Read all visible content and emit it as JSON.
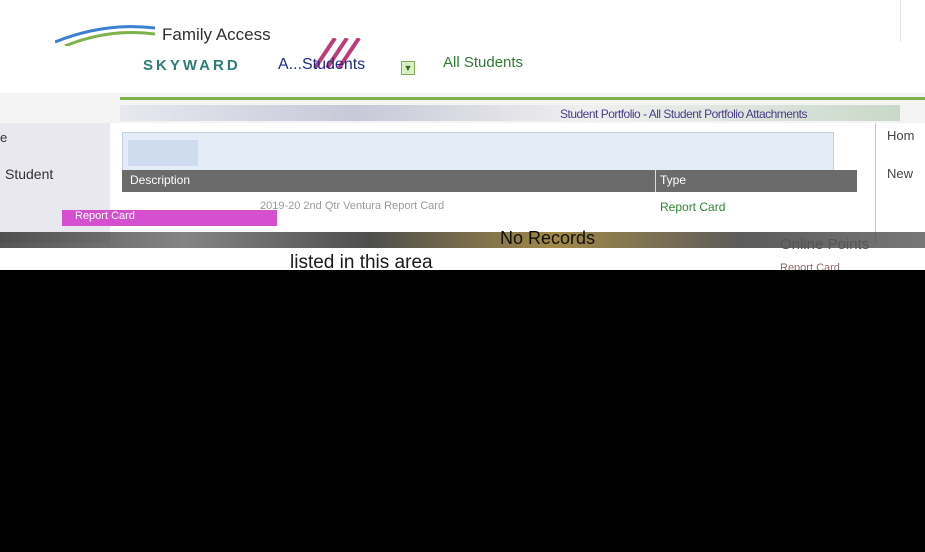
{
  "header": {
    "title": "Family Access",
    "brand": "SKYWARD",
    "students_dropdown": "A...Students",
    "all_students": "All Students"
  },
  "nav": {
    "page_title": "Student Portfolio - All Student Portfolio Attachments",
    "left_label": "e",
    "student_label": "Student"
  },
  "table": {
    "columns": [
      "Description",
      "Type"
    ],
    "rows": [
      {
        "description": "2019-20 2nd Qtr Ventura Report Card",
        "type": "Report Card"
      }
    ],
    "left_tag": "Report Card"
  },
  "messages": {
    "no_records": "No Records",
    "listed": "listed in this area"
  },
  "right_panel": {
    "home": "Hom",
    "new": "New",
    "online_points": "Online Points",
    "report_card": "Report Card"
  },
  "colors": {
    "accent_green": "#7fb24a",
    "brand_blue": "#1d2a8c",
    "highlight_pink": "#d64fd0",
    "header_gray": "#6b6b6b"
  }
}
